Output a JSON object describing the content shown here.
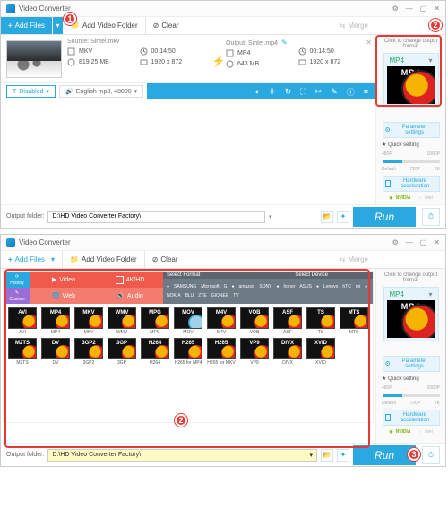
{
  "app_title": "Video Converter",
  "toolbar": {
    "add_files": "Add Files",
    "add_folder": "Add Video Folder",
    "clear": "Clear",
    "merge": "Merge"
  },
  "file": {
    "source_label": "Source: Sintel.mkv",
    "output_label": "Output: Sintel.mp4",
    "src": {
      "container": "MKV",
      "duration": "00:14:50",
      "size": "819.25 MB",
      "resolution": "1920 x 872"
    },
    "out": {
      "container": "MP4",
      "duration": "00:14:50",
      "size": "643 MB",
      "resolution": "1920 x 872"
    }
  },
  "subtitle": {
    "disabled": "Disabled",
    "audio_track": "English mp3, 48000"
  },
  "right": {
    "hint": "Click to change output format",
    "format": "MP4",
    "param": "Parameter settings",
    "quick": "Quick setting",
    "preset_row1": [
      "480P",
      "1080P"
    ],
    "preset_row2": [
      "Default",
      "720P",
      "2K"
    ],
    "hw": "Hardware acceleration",
    "nvidia": "NVIDIA",
    "intel": "intel"
  },
  "footer": {
    "label": "Output folder:",
    "path": "D:\\HD Video Converter Factory\\",
    "run": "Run"
  },
  "fmt_panel": {
    "history": "History",
    "custom": "Custom",
    "select_format": "Select Format",
    "select_device": "Select Device",
    "cats": {
      "video": "Video",
      "fourk": "4K/HD",
      "web": "Web",
      "audio": "Audio"
    },
    "brands": [
      "",
      "SAMSUNG",
      "Microsoft",
      "G",
      "",
      "amazon",
      "SONY",
      "",
      "honor",
      "ASUS",
      "",
      "Lenovo",
      "hTC",
      "mi",
      "",
      "NOKIA",
      "BLU",
      "ZTE",
      "GIONEE",
      "TV"
    ],
    "formats": [
      {
        "t": "AVI",
        "l": "AVI"
      },
      {
        "t": "MP4",
        "l": "MP4"
      },
      {
        "t": "MKV",
        "l": "MKV"
      },
      {
        "t": "WMV",
        "l": "WMV"
      },
      {
        "t": "MPG",
        "l": "MPG"
      },
      {
        "t": "MOV",
        "l": "MOV",
        "mov": true
      },
      {
        "t": "M4V",
        "l": "M4V"
      },
      {
        "t": "VOB",
        "l": "VOB"
      },
      {
        "t": "ASF",
        "l": "ASF"
      },
      {
        "t": "TS",
        "l": "TS"
      },
      {
        "t": "MTS",
        "l": "MTS"
      },
      {
        "t": "M2TS",
        "l": "M2TS"
      },
      {
        "t": "DV",
        "l": "DV"
      },
      {
        "t": "3GP2",
        "l": "3GP2"
      },
      {
        "t": "3GP",
        "l": "3GP"
      },
      {
        "t": "H264",
        "l": "H264"
      },
      {
        "t": "H265",
        "l": "H265 for MP4"
      },
      {
        "t": "H265",
        "l": "H265 for MKV"
      },
      {
        "t": "VP9",
        "l": "VP9"
      },
      {
        "t": "DIVX",
        "l": "DIVX"
      },
      {
        "t": "XVID",
        "l": "XVID"
      }
    ]
  },
  "callouts": {
    "one": "1",
    "two": "2",
    "three": "3"
  }
}
